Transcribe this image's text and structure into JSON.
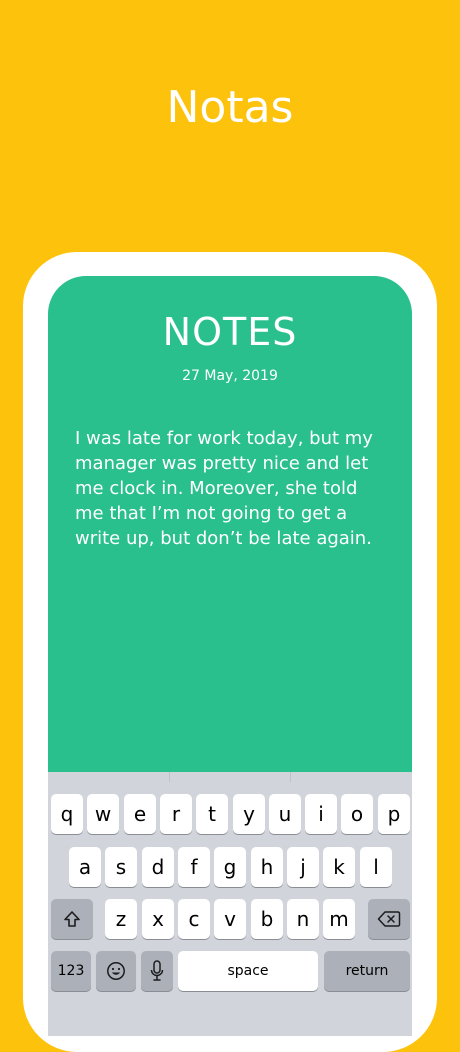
{
  "promo": {
    "title": "Notas"
  },
  "note": {
    "heading": "NOTES",
    "date": "27 May, 2019",
    "body": "I was late for work today, but my manager was pretty nice and let me clock in. Moreover, she told me that I’m not going to get a write up, but don’t be late again."
  },
  "keyboard": {
    "row1": [
      "q",
      "w",
      "e",
      "r",
      "t",
      "y",
      "u",
      "i",
      "o",
      "p"
    ],
    "row2": [
      "a",
      "s",
      "d",
      "f",
      "g",
      "h",
      "j",
      "k",
      "l"
    ],
    "row3": [
      "z",
      "x",
      "c",
      "v",
      "b",
      "n",
      "m"
    ],
    "numbers_label": "123",
    "space_label": "space",
    "return_label": "return",
    "shift_icon": "shift-icon",
    "delete_icon": "backspace-icon",
    "emoji_icon": "emoji-icon",
    "mic_icon": "microphone-icon"
  },
  "colors": {
    "background": "#FDC20C",
    "note_card": "#29C08D",
    "keyboard": "#D1D4DA"
  }
}
